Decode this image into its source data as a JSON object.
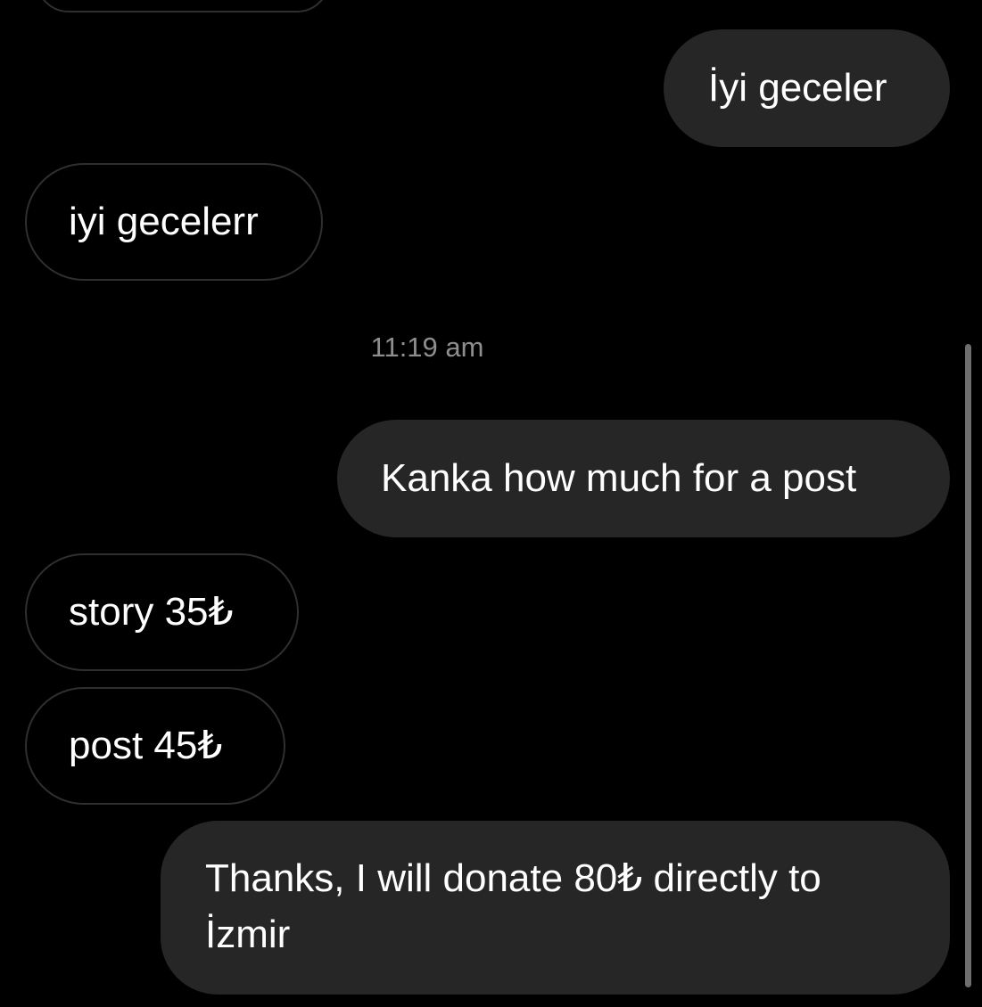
{
  "colors": {
    "background": "#000000",
    "outgoing_bubble": "#262626",
    "incoming_border": "#2f2f2f",
    "timestamp_text": "#8e8e8e",
    "text": "#ffffff",
    "scrollbar": "#6e6e6e"
  },
  "messages": [
    {
      "direction": "outgoing",
      "text": "İyi geceler"
    },
    {
      "direction": "incoming",
      "text": "iyi gecelerr"
    },
    {
      "direction": "outgoing",
      "text": "Kanka how much for a post"
    },
    {
      "direction": "incoming",
      "text": "story 35₺"
    },
    {
      "direction": "incoming",
      "text": "post 45₺"
    },
    {
      "direction": "outgoing",
      "text": "Thanks, I will donate 80₺ directly to İzmir"
    }
  ],
  "timestamp": "11:19 am"
}
